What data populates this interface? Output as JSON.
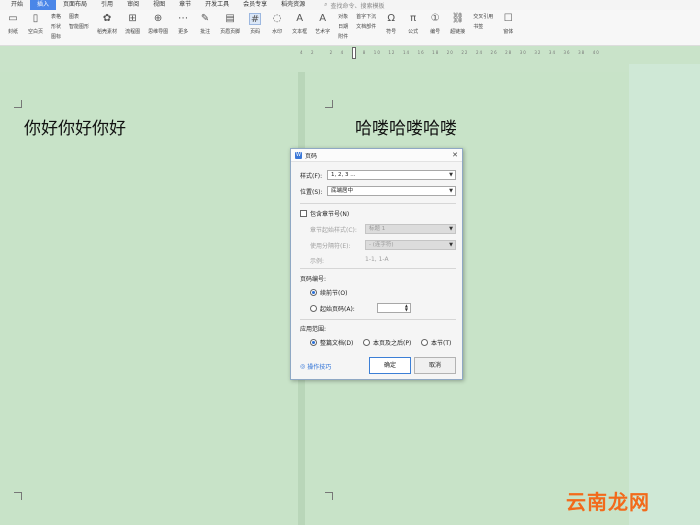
{
  "menu": {
    "tabs": [
      "开始",
      "插入",
      "页面布局",
      "引用",
      "审阅",
      "视图",
      "章节",
      "开发工具",
      "会员专享",
      "稻壳资源"
    ],
    "active_index": 1,
    "search_placeholder": "查找命令、搜索模板"
  },
  "ribbon": {
    "groups": [
      {
        "label": "封纸",
        "icon": "▭"
      },
      {
        "label": "空白页",
        "icon": "▯"
      },
      {
        "small": [
          "表格",
          "形状",
          "图标"
        ]
      },
      {
        "small": [
          "图表",
          "智能图形",
          ""
        ]
      },
      {
        "label": "稻壳素材",
        "icon": "✿"
      },
      {
        "label": "流程图",
        "icon": "⊞"
      },
      {
        "label": "思维导图",
        "icon": "⊕"
      },
      {
        "label": "更多",
        "icon": "⋯"
      },
      {
        "label": "批注",
        "icon": "✎"
      },
      {
        "label": "页眉页脚",
        "icon": "▤"
      },
      {
        "label": "页码",
        "icon": "#"
      },
      {
        "label": "水印",
        "icon": "◌"
      },
      {
        "label": "文本框",
        "icon": "A"
      },
      {
        "label": "艺术字",
        "icon": "A"
      },
      {
        "small": [
          "对象",
          "日期",
          "附件"
        ]
      },
      {
        "small": [
          "首字下沉",
          "文档部件",
          ""
        ]
      },
      {
        "label": "符号",
        "icon": "Ω"
      },
      {
        "label": "公式",
        "icon": "π"
      },
      {
        "label": "编号",
        "icon": "①"
      },
      {
        "label": "超链接",
        "icon": "⛓"
      },
      {
        "small": [
          "交叉引用",
          "书签",
          ""
        ]
      },
      {
        "label": "窗体",
        "icon": "☐"
      }
    ]
  },
  "ruler": {
    "ticks": [
      "4",
      "2",
      "",
      "2",
      "4",
      "6",
      "8",
      "10",
      "12",
      "14",
      "16",
      "18",
      "20",
      "22",
      "24",
      "26",
      "28",
      "30",
      "32",
      "34",
      "36",
      "38",
      "40"
    ]
  },
  "document": {
    "left_text": "你好你好你好",
    "right_text": "哈喽哈喽哈喽"
  },
  "dialog": {
    "title": "页码",
    "style_label": "样式(F):",
    "style_value": "1, 2, 3 ...",
    "position_label": "位置(S):",
    "position_value": "底端居中",
    "include_chapter_label": "包含章节号(N)",
    "chapter_start_label": "章节起始样式(C):",
    "chapter_start_value": "标题 1",
    "separator_label": "使用分隔符(E):",
    "separator_value": "- (连字符)",
    "example_label": "示例:",
    "example_value": "1-1, 1-A",
    "numbering_label": "页码编号:",
    "continue_label": "续前节(O)",
    "start_label": "起始页码(A):",
    "start_value": "",
    "apply_label": "应用范围:",
    "apply_whole": "整篇文档(D)",
    "apply_after": "本页及之后(P)",
    "apply_section": "本节(T)",
    "tips_label": "操作技巧",
    "ok_label": "确定",
    "cancel_label": "取消"
  },
  "watermark": "云南龙网"
}
